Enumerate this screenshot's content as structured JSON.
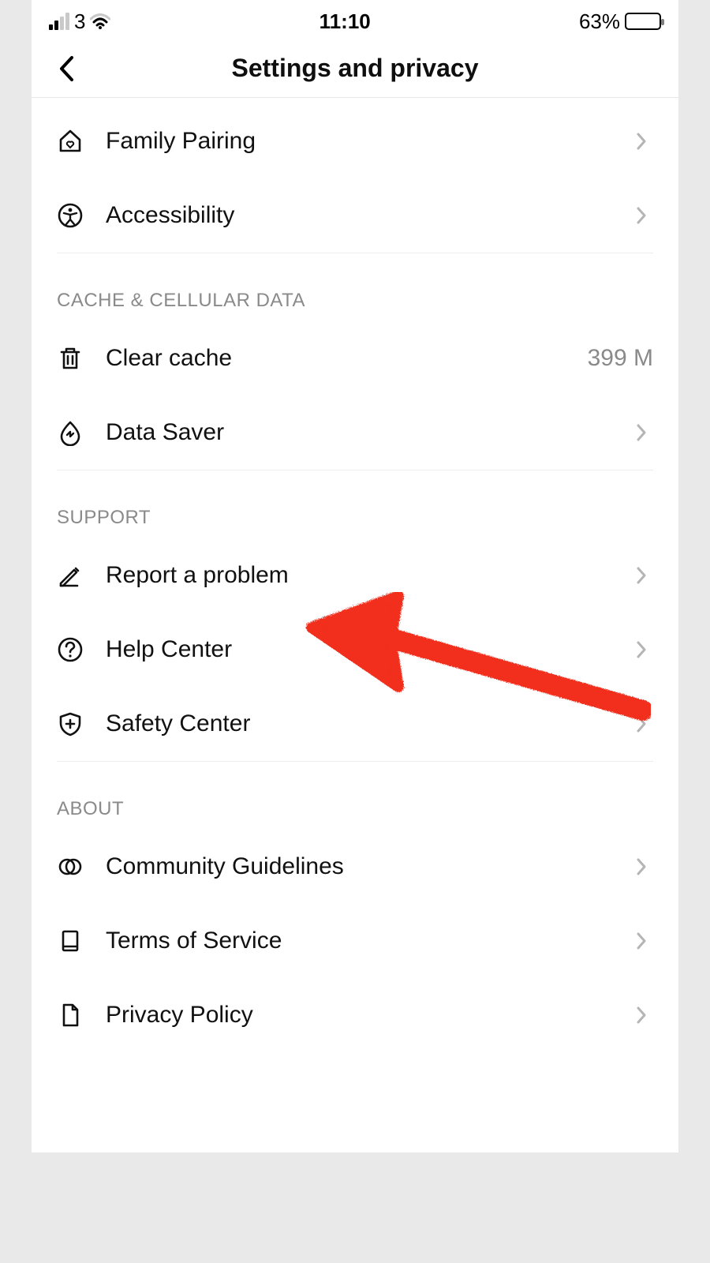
{
  "statusbar": {
    "carrier": "3",
    "time": "11:10",
    "battery_percent": "63%",
    "battery_fill": 63
  },
  "header": {
    "title": "Settings and privacy"
  },
  "sections": {
    "top": {
      "family_pairing": "Family Pairing",
      "accessibility": "Accessibility"
    },
    "cache": {
      "header": "CACHE & CELLULAR DATA",
      "clear_cache": "Clear cache",
      "clear_cache_value": "399 M",
      "data_saver": "Data Saver"
    },
    "support": {
      "header": "SUPPORT",
      "report_problem": "Report a problem",
      "help_center": "Help Center",
      "safety_center": "Safety Center"
    },
    "about": {
      "header": "ABOUT",
      "community_guidelines": "Community Guidelines",
      "tos": "Terms of Service",
      "privacy_policy": "Privacy Policy"
    }
  },
  "annotation": {
    "type": "hand-drawn-arrow",
    "target": "report-a-problem-row",
    "color": "#f22d1d"
  }
}
